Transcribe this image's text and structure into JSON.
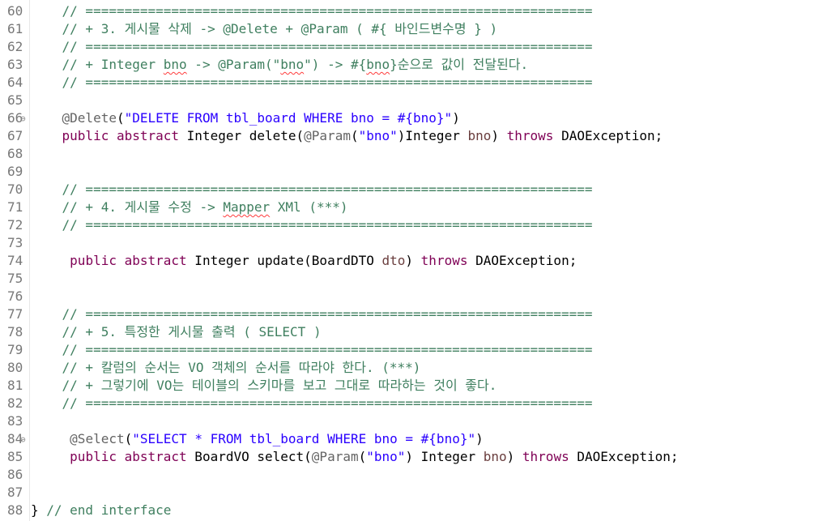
{
  "editor": {
    "lines": [
      {
        "num": "60",
        "fold": "",
        "tokens": [
          {
            "t": "    // =================================================================",
            "k": "comment"
          }
        ]
      },
      {
        "num": "61",
        "fold": "",
        "tokens": [
          {
            "t": "    // + 3. 게시물 삭제 -> @Delete + @Param ( #{ 바인드변수명 } )",
            "k": "comment"
          }
        ]
      },
      {
        "num": "62",
        "fold": "",
        "tokens": [
          {
            "t": "    // =================================================================",
            "k": "comment"
          }
        ]
      },
      {
        "num": "63",
        "fold": "",
        "tokens": [
          {
            "t": "    // + Integer ",
            "k": "comment"
          },
          {
            "t": "bno",
            "k": "comment",
            "sp": true
          },
          {
            "t": " -> @Param(\"",
            "k": "comment"
          },
          {
            "t": "bno",
            "k": "comment",
            "sp": true
          },
          {
            "t": "\") -> #{",
            "k": "comment"
          },
          {
            "t": "bno",
            "k": "comment",
            "sp": true
          },
          {
            "t": "}순으로 값이 전달된다.",
            "k": "comment"
          }
        ]
      },
      {
        "num": "64",
        "fold": "",
        "tokens": [
          {
            "t": "    // =================================================================",
            "k": "comment"
          }
        ]
      },
      {
        "num": "65",
        "fold": "",
        "tokens": []
      },
      {
        "num": "66",
        "fold": "⊖",
        "tokens": [
          {
            "t": "    ",
            "k": "plain"
          },
          {
            "t": "@Delete",
            "k": "annotation"
          },
          {
            "t": "(",
            "k": "plain"
          },
          {
            "t": "\"DELETE FROM tbl_board WHERE bno = #{bno}\"",
            "k": "string"
          },
          {
            "t": ")",
            "k": "plain"
          }
        ]
      },
      {
        "num": "67",
        "fold": "",
        "tokens": [
          {
            "t": "    ",
            "k": "plain"
          },
          {
            "t": "public",
            "k": "keyword"
          },
          {
            "t": " ",
            "k": "plain"
          },
          {
            "t": "abstract",
            "k": "keyword"
          },
          {
            "t": " Integer delete(",
            "k": "plain"
          },
          {
            "t": "@Param",
            "k": "annotation"
          },
          {
            "t": "(",
            "k": "plain"
          },
          {
            "t": "\"bno\"",
            "k": "string"
          },
          {
            "t": ")Integer ",
            "k": "plain"
          },
          {
            "t": "bno",
            "k": "param"
          },
          {
            "t": ") ",
            "k": "plain"
          },
          {
            "t": "throws",
            "k": "keyword"
          },
          {
            "t": " DAOException;",
            "k": "plain"
          }
        ]
      },
      {
        "num": "68",
        "fold": "",
        "tokens": []
      },
      {
        "num": "69",
        "fold": "",
        "tokens": []
      },
      {
        "num": "70",
        "fold": "",
        "tokens": [
          {
            "t": "    // =================================================================",
            "k": "comment"
          }
        ]
      },
      {
        "num": "71",
        "fold": "",
        "tokens": [
          {
            "t": "    // + 4. 게시물 수정 -> ",
            "k": "comment"
          },
          {
            "t": "Mapper",
            "k": "comment",
            "sp": true
          },
          {
            "t": " XMl (***)",
            "k": "comment"
          }
        ]
      },
      {
        "num": "72",
        "fold": "",
        "tokens": [
          {
            "t": "    // =================================================================",
            "k": "comment"
          }
        ]
      },
      {
        "num": "73",
        "fold": "",
        "tokens": []
      },
      {
        "num": "74",
        "fold": "",
        "tokens": [
          {
            "t": "     ",
            "k": "plain"
          },
          {
            "t": "public",
            "k": "keyword"
          },
          {
            "t": " ",
            "k": "plain"
          },
          {
            "t": "abstract",
            "k": "keyword"
          },
          {
            "t": " Integer update(BoardDTO ",
            "k": "plain"
          },
          {
            "t": "dto",
            "k": "param"
          },
          {
            "t": ") ",
            "k": "plain"
          },
          {
            "t": "throws",
            "k": "keyword"
          },
          {
            "t": " DAOException;",
            "k": "plain"
          }
        ]
      },
      {
        "num": "75",
        "fold": "",
        "tokens": []
      },
      {
        "num": "76",
        "fold": "",
        "tokens": []
      },
      {
        "num": "77",
        "fold": "",
        "tokens": [
          {
            "t": "    // =================================================================",
            "k": "comment"
          }
        ]
      },
      {
        "num": "78",
        "fold": "",
        "tokens": [
          {
            "t": "    // + 5. 특정한 게시물 출력 ( SELECT )",
            "k": "comment"
          }
        ]
      },
      {
        "num": "79",
        "fold": "",
        "tokens": [
          {
            "t": "    // =================================================================",
            "k": "comment"
          }
        ]
      },
      {
        "num": "80",
        "fold": "",
        "tokens": [
          {
            "t": "    // + 칼럼의 순서는 VO 객체의 순서를 따라야 한다. (***)",
            "k": "comment"
          }
        ]
      },
      {
        "num": "81",
        "fold": "",
        "tokens": [
          {
            "t": "    // + 그렇기에 VO는 테이블의 스키마를 보고 그대로 따라하는 것이 좋다.",
            "k": "comment"
          }
        ]
      },
      {
        "num": "82",
        "fold": "",
        "tokens": [
          {
            "t": "    // =================================================================",
            "k": "comment"
          }
        ]
      },
      {
        "num": "83",
        "fold": "",
        "tokens": []
      },
      {
        "num": "84",
        "fold": "⊖",
        "tokens": [
          {
            "t": "     ",
            "k": "plain"
          },
          {
            "t": "@Select",
            "k": "annotation"
          },
          {
            "t": "(",
            "k": "plain"
          },
          {
            "t": "\"SELECT * FROM tbl_board WHERE bno = #{bno}\"",
            "k": "string"
          },
          {
            "t": ")",
            "k": "plain"
          }
        ]
      },
      {
        "num": "85",
        "fold": "",
        "tokens": [
          {
            "t": "     ",
            "k": "plain"
          },
          {
            "t": "public",
            "k": "keyword"
          },
          {
            "t": " ",
            "k": "plain"
          },
          {
            "t": "abstract",
            "k": "keyword"
          },
          {
            "t": " BoardVO select(",
            "k": "plain"
          },
          {
            "t": "@Param",
            "k": "annotation"
          },
          {
            "t": "(",
            "k": "plain"
          },
          {
            "t": "\"bno\"",
            "k": "string"
          },
          {
            "t": ") Integer ",
            "k": "plain"
          },
          {
            "t": "bno",
            "k": "param"
          },
          {
            "t": ") ",
            "k": "plain"
          },
          {
            "t": "throws",
            "k": "keyword"
          },
          {
            "t": " DAOException;",
            "k": "plain"
          }
        ]
      },
      {
        "num": "86",
        "fold": "",
        "tokens": []
      },
      {
        "num": "87",
        "fold": "",
        "tokens": []
      },
      {
        "num": "88",
        "fold": "",
        "tokens": [
          {
            "t": "} ",
            "k": "plain"
          },
          {
            "t": "// end interface",
            "k": "comment"
          }
        ]
      }
    ]
  }
}
